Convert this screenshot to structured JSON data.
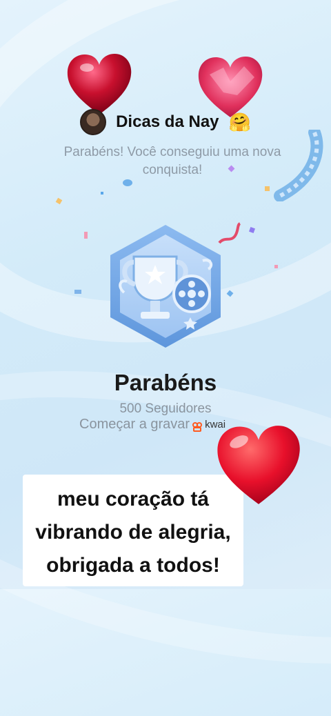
{
  "profile": {
    "name": "Dicas da Nay",
    "emoji": "🤗"
  },
  "message": {
    "line1": "Parabéns! Você conseguiu uma nova",
    "line2": "conquista!"
  },
  "achievement": {
    "title": "Parabéns",
    "followers": "500 Seguidores",
    "start_recording": "Começar a gravar",
    "brand": "kwai"
  },
  "caption": {
    "line1": "meu coração tá",
    "line2": "vibrando de alegria,",
    "line3": "obrigada a todos!"
  },
  "colors": {
    "heart_red": "#e01b3c",
    "badge_blue": "#6fa8e6",
    "bg": "#d3ebf9"
  }
}
